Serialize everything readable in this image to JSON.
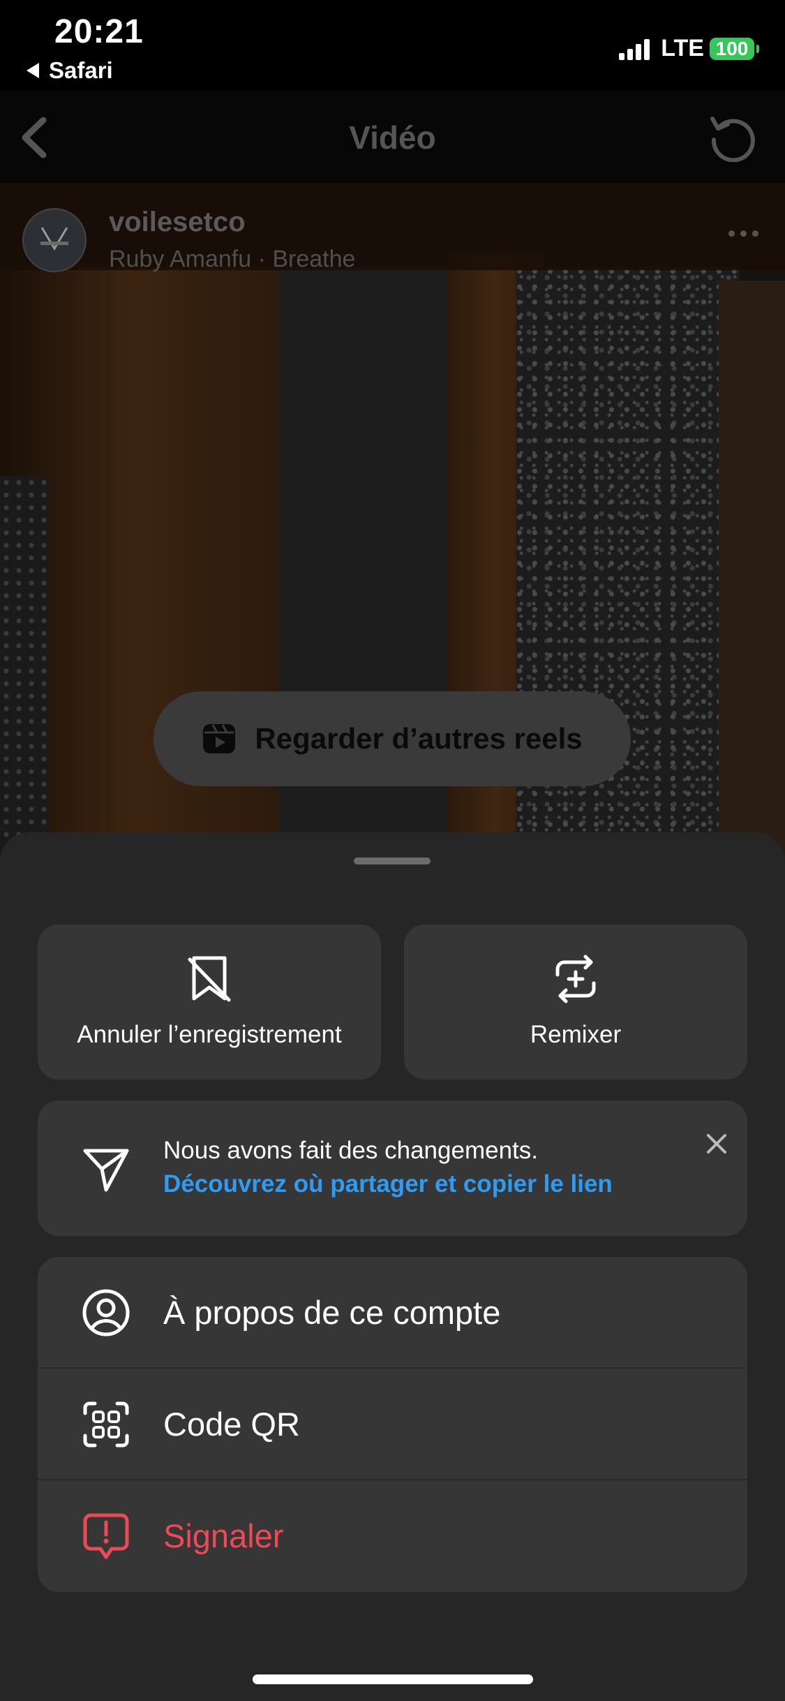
{
  "status_bar": {
    "time": "20:21",
    "back_app": "Safari",
    "network": "LTE",
    "battery": "100"
  },
  "nav": {
    "title": "Vidéo",
    "back_icon": "chevron-left-icon",
    "reload_icon": "reload-icon"
  },
  "post": {
    "username": "voilesetco",
    "music": "Ruby Amanfu · Breathe",
    "more_icon": "more-horizontal-icon"
  },
  "reels_button": {
    "label": "Regarder d’autres reels",
    "icon": "reels-icon"
  },
  "sheet": {
    "actions": [
      {
        "label": "Annuler l’enregistrement",
        "icon": "unsave-bookmark-icon"
      },
      {
        "label": "Remixer",
        "icon": "remix-icon"
      }
    ],
    "notice": {
      "text": "Nous avons fait des changements.",
      "link": "Découvrez où partager et copier le lien",
      "icon": "send-icon",
      "close_icon": "close-icon"
    },
    "menu": [
      {
        "label": "À propos de ce compte",
        "icon": "account-icon"
      },
      {
        "label": "Code QR",
        "icon": "qr-code-icon"
      },
      {
        "label": "Signaler",
        "icon": "report-icon"
      }
    ]
  },
  "colors": {
    "sheet_bg": "#262626",
    "card_bg": "#363636",
    "link": "#2e9cf4",
    "danger": "#ed4956",
    "battery": "#34c759"
  }
}
